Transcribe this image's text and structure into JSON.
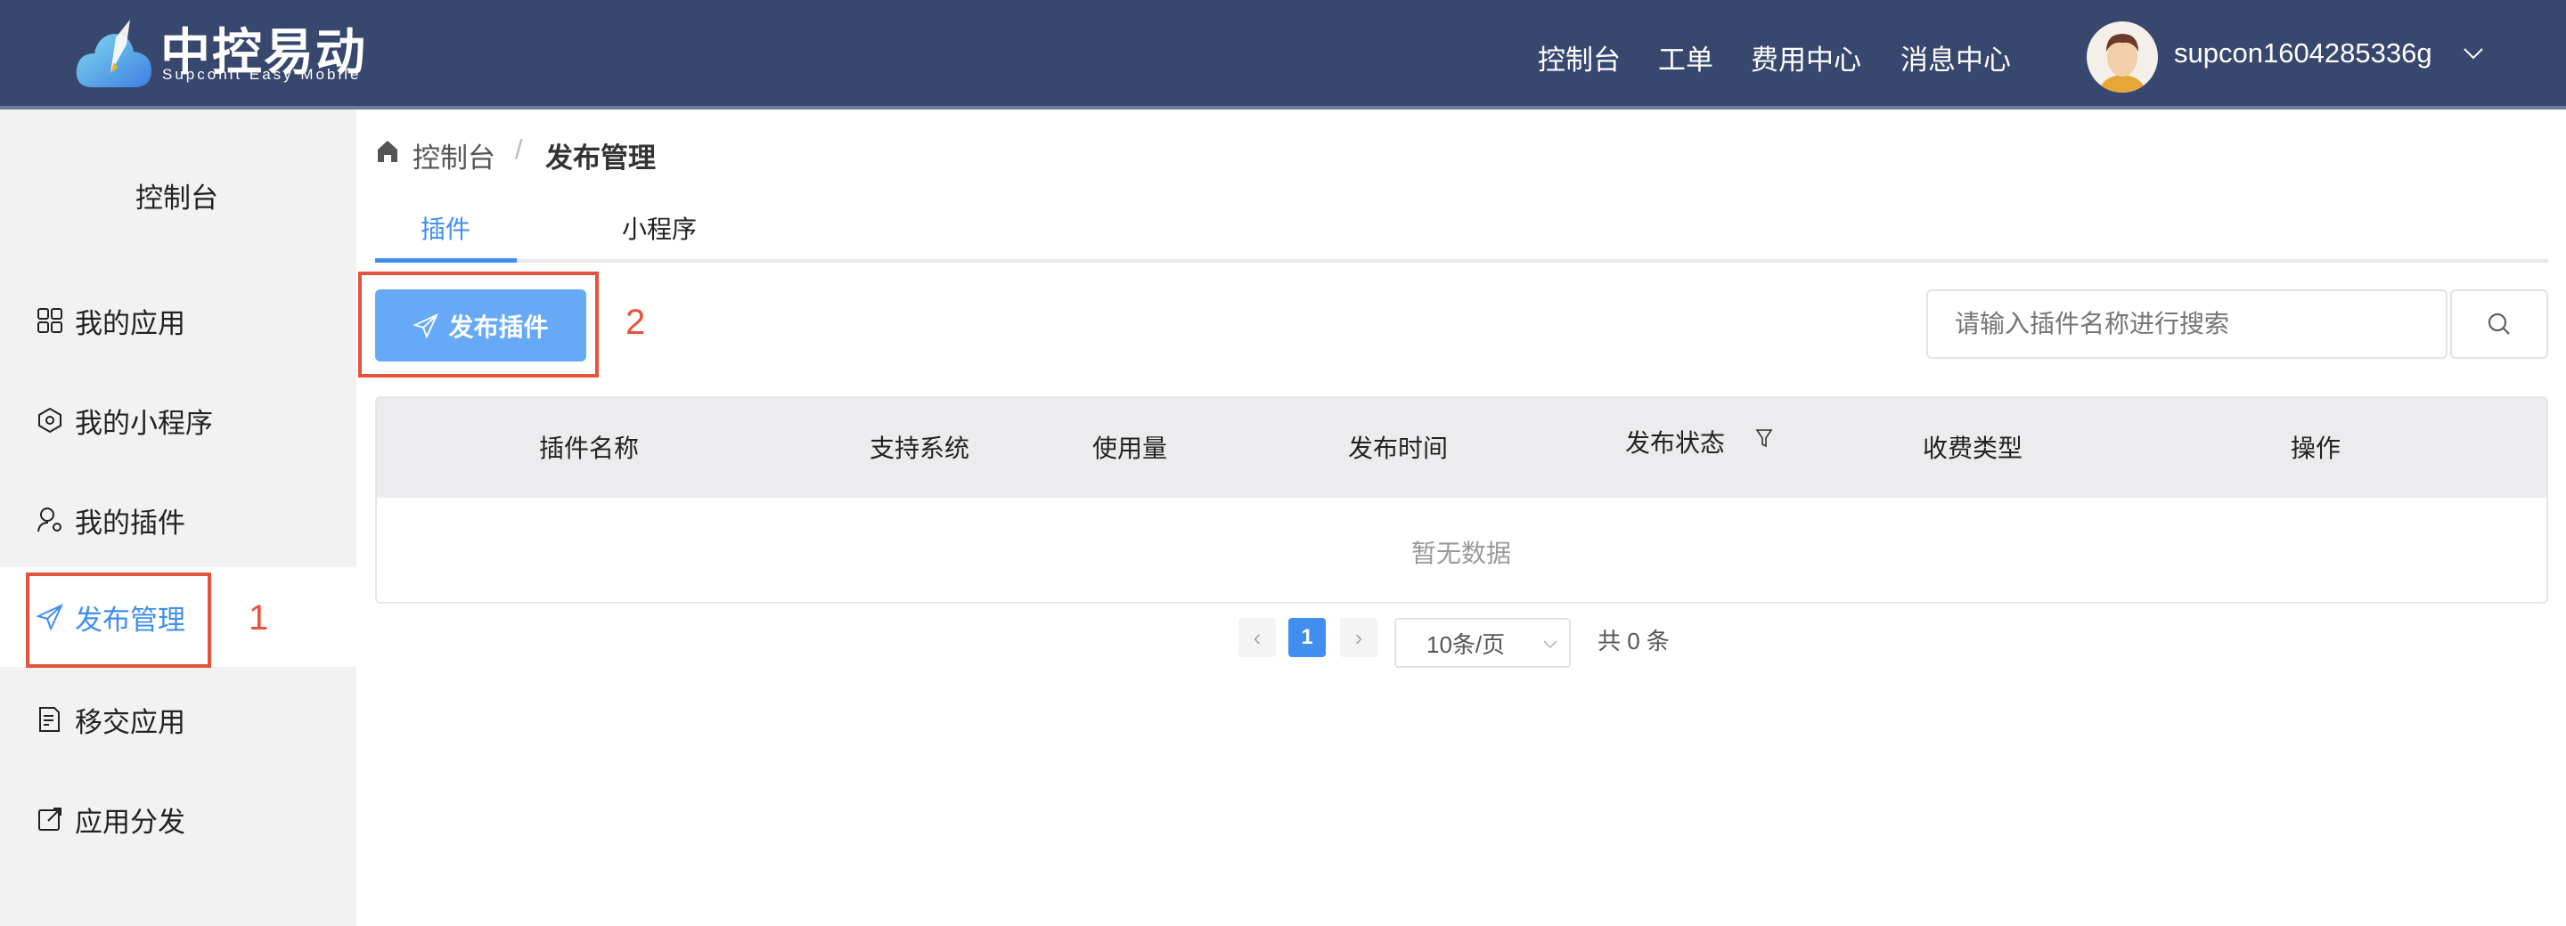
{
  "header": {
    "logo_text": "中控易动",
    "logo_subtitle": "Supconit Easy Mobile",
    "nav": [
      "控制台",
      "工单",
      "费用中心",
      "消息中心"
    ],
    "username": "supcon1604285336g",
    "bg_color": "#38476e"
  },
  "sidebar": {
    "title": "控制台",
    "items": [
      {
        "label": "我的应用",
        "icon": "grid-icon"
      },
      {
        "label": "我的小程序",
        "icon": "mini-program-icon"
      },
      {
        "label": "我的插件",
        "icon": "user-plugin-icon"
      },
      {
        "label": "发布管理",
        "icon": "send-icon",
        "active": true
      },
      {
        "label": "移交应用",
        "icon": "transfer-doc-icon"
      },
      {
        "label": "应用分发",
        "icon": "share-icon"
      }
    ]
  },
  "annotations": {
    "one": "1",
    "two": "2",
    "color": "#e5533c"
  },
  "breadcrumb": {
    "home": "控制台",
    "current": "发布管理"
  },
  "tabs": [
    {
      "label": "插件",
      "active": true
    },
    {
      "label": "小程序"
    }
  ],
  "toolbar": {
    "publish_label": "发布插件",
    "search_placeholder": "请输入插件名称进行搜索"
  },
  "table": {
    "columns": [
      "插件名称",
      "支持系统",
      "使用量",
      "发布时间",
      "发布状态",
      "收费类型",
      "操作"
    ],
    "empty_text": "暂无数据"
  },
  "pagination": {
    "current_page": "1",
    "page_size": "10条/页",
    "total": "共 0 条"
  },
  "accent_color": "#3f8ef0"
}
